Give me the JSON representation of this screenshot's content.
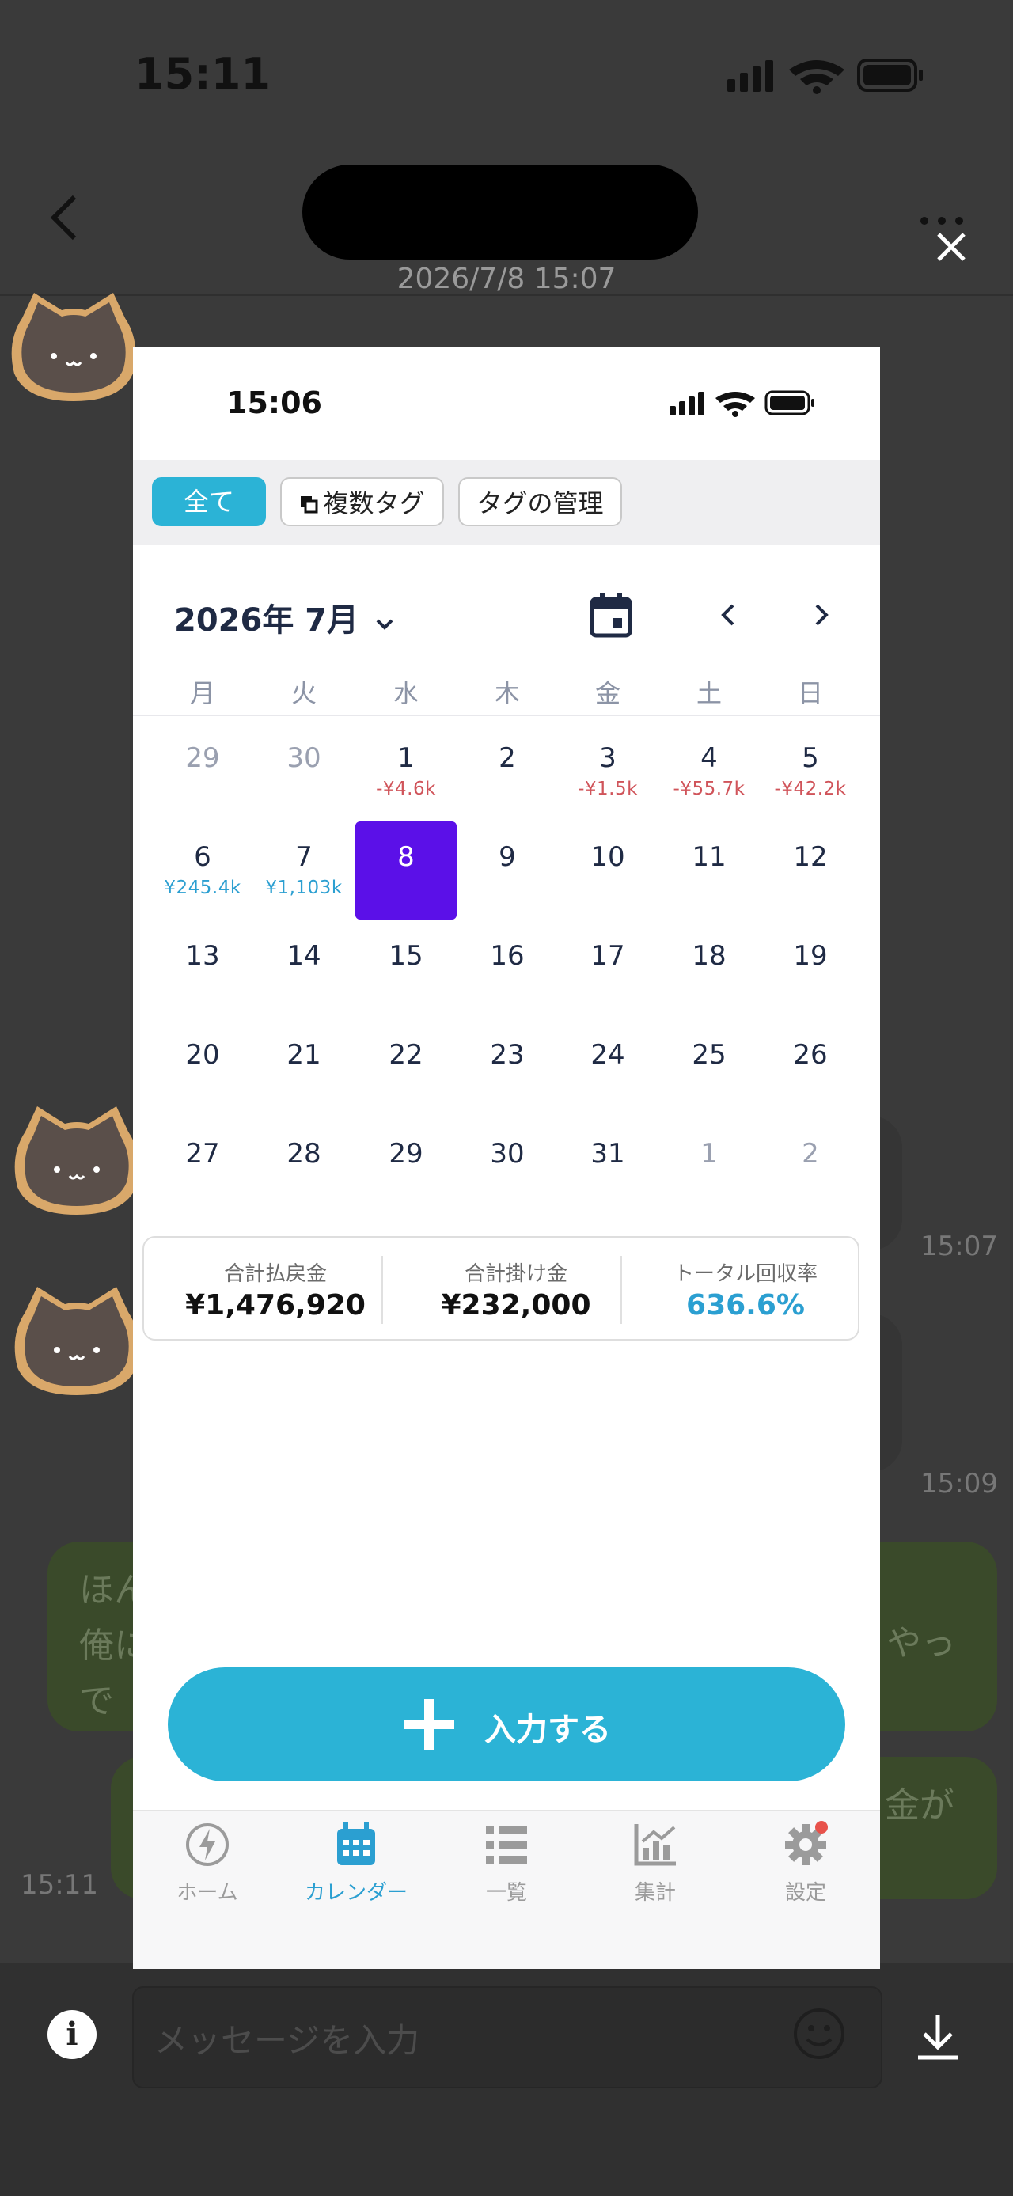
{
  "outer": {
    "status_time": "15:11",
    "header_subtitle": "2026/7/8 15:07",
    "time_1": "15:07",
    "time_2": "15:09",
    "time_3": "15:11",
    "bubble_1_line1": "ほん",
    "bubble_1_line2": "俺に",
    "bubble_1_line3": "で",
    "bubble_1_suffix": "やっ",
    "bubble_2_suffix": "金が",
    "message_placeholder": "メッセージを入力"
  },
  "shot": {
    "status_time": "15:06",
    "tags": {
      "all": "全て",
      "multi": "複数タグ",
      "manage": "タグの管理"
    },
    "month_title": "2026年 7月",
    "weekdays": [
      "月",
      "火",
      "水",
      "木",
      "金",
      "土",
      "日"
    ],
    "weeks": [
      [
        {
          "d": "29",
          "dim": true
        },
        {
          "d": "30",
          "dim": true
        },
        {
          "d": "1",
          "amt": "-¥4.6k",
          "sign": "neg"
        },
        {
          "d": "2"
        },
        {
          "d": "3",
          "amt": "-¥1.5k",
          "sign": "neg"
        },
        {
          "d": "4",
          "amt": "-¥55.7k",
          "sign": "neg"
        },
        {
          "d": "5",
          "amt": "-¥42.2k",
          "sign": "neg"
        }
      ],
      [
        {
          "d": "6",
          "amt": "¥245.4k",
          "sign": "pos"
        },
        {
          "d": "7",
          "amt": "¥1,103k",
          "sign": "pos"
        },
        {
          "d": "8",
          "selected": true
        },
        {
          "d": "9"
        },
        {
          "d": "10"
        },
        {
          "d": "11"
        },
        {
          "d": "12"
        }
      ],
      [
        {
          "d": "13"
        },
        {
          "d": "14"
        },
        {
          "d": "15"
        },
        {
          "d": "16"
        },
        {
          "d": "17"
        },
        {
          "d": "18"
        },
        {
          "d": "19"
        }
      ],
      [
        {
          "d": "20"
        },
        {
          "d": "21"
        },
        {
          "d": "22"
        },
        {
          "d": "23"
        },
        {
          "d": "24"
        },
        {
          "d": "25"
        },
        {
          "d": "26"
        }
      ],
      [
        {
          "d": "27"
        },
        {
          "d": "28"
        },
        {
          "d": "29"
        },
        {
          "d": "30"
        },
        {
          "d": "31"
        },
        {
          "d": "1",
          "dim": true
        },
        {
          "d": "2",
          "dim": true
        }
      ]
    ],
    "summary": {
      "payout_label": "合計払戻金",
      "payout_value": "¥1,476,920",
      "bet_label": "合計掛け金",
      "bet_value": "¥232,000",
      "rate_label": "トータル回収率",
      "rate_value": "636.6%"
    },
    "input_button": "入力する",
    "tabs": [
      {
        "label": "ホーム",
        "icon": "lightning-icon"
      },
      {
        "label": "カレンダー",
        "icon": "calendar-icon",
        "active": true
      },
      {
        "label": "一覧",
        "icon": "list-icon"
      },
      {
        "label": "集計",
        "icon": "chart-icon"
      },
      {
        "label": "設定",
        "icon": "gear-icon",
        "badge": true
      }
    ],
    "colors": {
      "accent": "#2bb3d6",
      "selected": "#5b10e8",
      "negative": "#d0545a",
      "positive": "#2b9fd1"
    }
  }
}
